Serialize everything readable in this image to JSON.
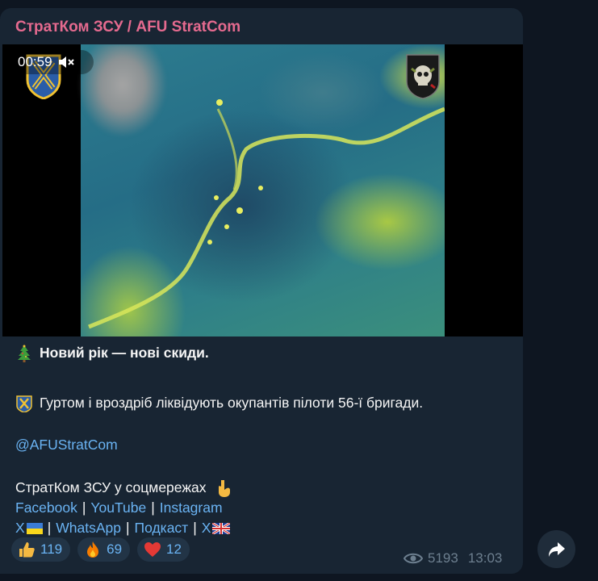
{
  "channel": {
    "name": "СтратКом ЗСУ / AFU StratCom"
  },
  "video": {
    "timer": "00:59",
    "muted": true
  },
  "post": {
    "headline": "Новий рік — нові скиди.",
    "body": "Гуртом і вроздріб ліквідують окупантів пілоти 56-ї бригади.",
    "handle": "@AFUStratCom",
    "social_intro": "СтратКом ЗСУ у соцмережах",
    "links_row1": [
      {
        "label": "Facebook"
      },
      {
        "label": "YouTube"
      },
      {
        "label": "Instagram"
      }
    ],
    "links_row2": [
      {
        "label": "X"
      },
      {
        "label": "WhatsApp"
      },
      {
        "label": "Подкаст"
      },
      {
        "label": "X"
      }
    ],
    "separator": "|"
  },
  "reactions": [
    {
      "emoji": "thumbs-up",
      "count": "119"
    },
    {
      "emoji": "fire",
      "count": "69"
    },
    {
      "emoji": "heart",
      "count": "12"
    }
  ],
  "meta": {
    "views": "5193",
    "time": "13:03"
  },
  "colors": {
    "background": "#0e1621",
    "bubble": "#182533",
    "channel_name": "#e56a8f",
    "link": "#6ab3f3",
    "meta": "#6d7f8f"
  }
}
